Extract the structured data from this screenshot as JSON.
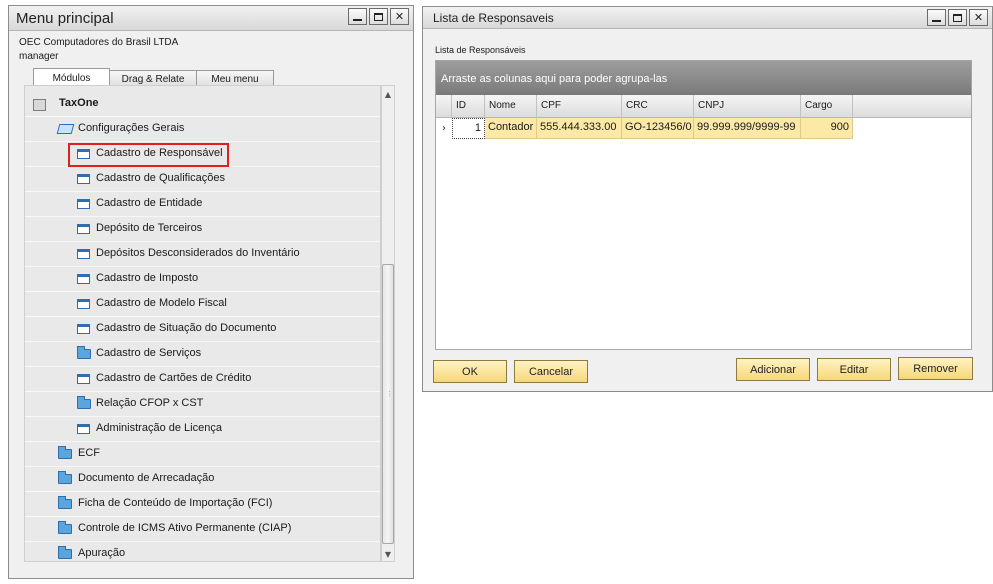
{
  "menu_window": {
    "title": "Menu principal",
    "company": "OEC Computadores do Brasil LTDA",
    "user": "manager",
    "tabs": [
      {
        "label": "Módulos"
      },
      {
        "label": "Drag & Relate"
      },
      {
        "label": "Meu menu"
      }
    ],
    "tree": [
      {
        "label": "TaxOne",
        "icon": "module-icon",
        "level": 0
      },
      {
        "label": "Configurações Gerais",
        "icon": "folder-open-icon",
        "level": 1
      },
      {
        "label": "Cadastro de Responsável",
        "icon": "form-icon",
        "level": 2,
        "highlighted": true
      },
      {
        "label": "Cadastro de Qualificações",
        "icon": "form-icon",
        "level": 2
      },
      {
        "label": "Cadastro de Entidade",
        "icon": "form-icon",
        "level": 2
      },
      {
        "label": "Depósito de Terceiros",
        "icon": "form-icon",
        "level": 2
      },
      {
        "label": "Depósitos Desconsiderados do Inventário",
        "icon": "form-icon",
        "level": 2
      },
      {
        "label": "Cadastro de Imposto",
        "icon": "form-icon",
        "level": 2
      },
      {
        "label": "Cadastro de Modelo Fiscal",
        "icon": "form-icon",
        "level": 2
      },
      {
        "label": "Cadastro de Situação do Documento",
        "icon": "form-icon",
        "level": 2
      },
      {
        "label": "Cadastro de Serviços",
        "icon": "folder-icon",
        "level": 2
      },
      {
        "label": "Cadastro de Cartões de Crédito",
        "icon": "form-icon",
        "level": 2
      },
      {
        "label": "Relação CFOP x CST",
        "icon": "folder-icon",
        "level": 2
      },
      {
        "label": "Administração de Licença",
        "icon": "form-icon",
        "level": 2
      },
      {
        "label": "ECF",
        "icon": "folder-icon",
        "level": 1
      },
      {
        "label": "Documento de Arrecadação",
        "icon": "folder-icon",
        "level": 1
      },
      {
        "label": "Ficha de Conteúdo de Importação (FCI)",
        "icon": "folder-icon",
        "level": 1
      },
      {
        "label": "Controle de ICMS Ativo Permanente (CIAP)",
        "icon": "folder-icon",
        "level": 1
      },
      {
        "label": "Apuração",
        "icon": "folder-icon",
        "level": 1
      }
    ]
  },
  "list_window": {
    "title": "Lista de Responsaveis",
    "subtitle": "Lista de Responsáveis",
    "group_panel": "Arraste as colunas aqui para poder agrupa-las",
    "columns": [
      "ID",
      "Nome",
      "CPF",
      "CRC",
      "CNPJ",
      "Cargo"
    ],
    "rows": [
      [
        "1",
        "Contador",
        "555.444.333.00",
        "GO-123456/0",
        "99.999.999/9999-99",
        "900"
      ]
    ],
    "buttons": {
      "ok": "OK",
      "cancel": "Cancelar",
      "add": "Adicionar",
      "edit": "Editar",
      "remove": "Remover"
    }
  },
  "colors": {
    "selected_row": "#fde9a6",
    "button_face": "#f6d77a",
    "highlight_border": "#e02020",
    "group_panel": "#8a8a8a"
  }
}
